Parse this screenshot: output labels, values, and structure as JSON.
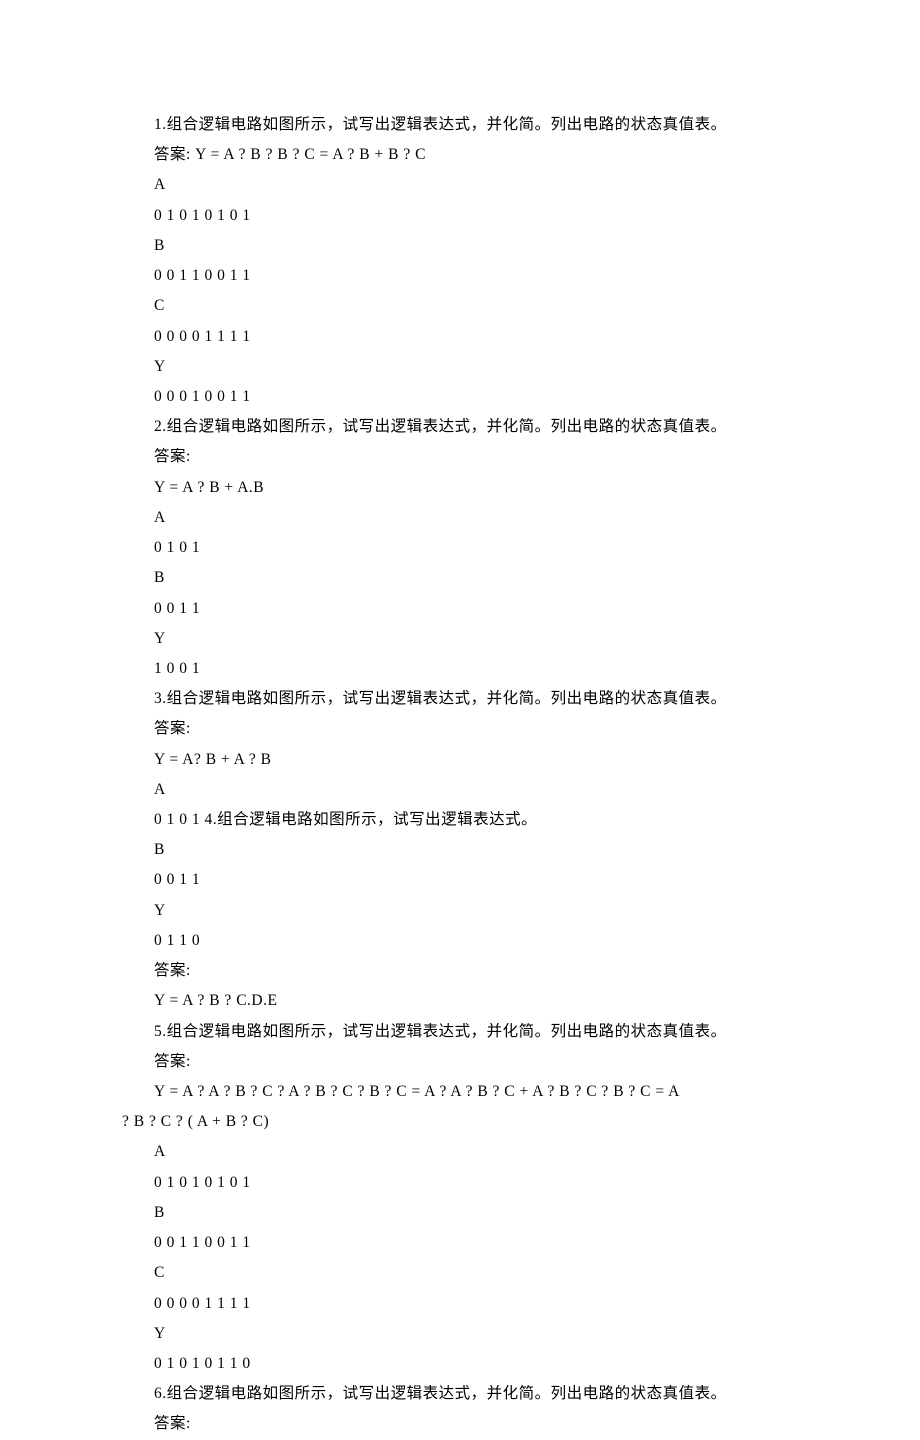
{
  "lines": [
    {
      "cls": "indent",
      "text": "1.组合逻辑电路如图所示，试写出逻辑表达式，并化简。列出电路的状态真值表。"
    },
    {
      "cls": "indent",
      "text": "答案: Y = A ? B ? B ? C = A ? B + B ? C"
    },
    {
      "cls": "indent",
      "text": "A"
    },
    {
      "cls": "indent",
      "text": "0 1 0 1 0 1 0 1"
    },
    {
      "cls": "indent",
      "text": "B"
    },
    {
      "cls": "indent",
      "text": "0 0 1 1 0 0 1 1"
    },
    {
      "cls": "indent",
      "text": "C"
    },
    {
      "cls": "indent",
      "text": "0 0 0 0 1 1 1 1"
    },
    {
      "cls": "indent",
      "text": "Y"
    },
    {
      "cls": "indent",
      "text": "0 0 0 1 0 0 1 1"
    },
    {
      "cls": "indent",
      "text": "2.组合逻辑电路如图所示，试写出逻辑表达式，并化简。列出电路的状态真值表。"
    },
    {
      "cls": "indent",
      "text": "答案:"
    },
    {
      "cls": "indent",
      "text": "Y = A ? B + A.B"
    },
    {
      "cls": "indent",
      "text": "A"
    },
    {
      "cls": "indent",
      "text": "0 1 0 1"
    },
    {
      "cls": "indent",
      "text": "B"
    },
    {
      "cls": "indent",
      "text": "0 0 1 1"
    },
    {
      "cls": "indent",
      "text": "Y"
    },
    {
      "cls": "indent",
      "text": "1 0 0 1"
    },
    {
      "cls": "indent",
      "text": "3.组合逻辑电路如图所示，试写出逻辑表达式，并化简。列出电路的状态真值表。"
    },
    {
      "cls": "indent",
      "text": "答案:"
    },
    {
      "cls": "indent",
      "text": "Y = A? B + A ? B"
    },
    {
      "cls": "indent",
      "text": "A"
    },
    {
      "cls": "indent",
      "text": "0 1 0 1 4.组合逻辑电路如图所示，试写出逻辑表达式。"
    },
    {
      "cls": "indent",
      "text": "B"
    },
    {
      "cls": "indent",
      "text": "0 0 1 1"
    },
    {
      "cls": "indent",
      "text": "Y"
    },
    {
      "cls": "indent",
      "text": "0 1 1 0"
    },
    {
      "cls": "indent",
      "text": "答案:"
    },
    {
      "cls": "indent",
      "text": "Y = A ? B ? C.D.E"
    },
    {
      "cls": "indent",
      "text": "5.组合逻辑电路如图所示，试写出逻辑表达式，并化简。列出电路的状态真值表。"
    },
    {
      "cls": "indent",
      "text": "答案:"
    },
    {
      "cls": "indent",
      "text": "Y = A ? A ? B ? C ? A ? B ? C ? B ? C = A ? A ? B ? C + A ? B ? C ? B ? C = A"
    },
    {
      "cls": "no-indent",
      "text": "? B ? C ? ( A + B ? C)"
    },
    {
      "cls": "indent",
      "text": "A"
    },
    {
      "cls": "indent",
      "text": "0 1 0 1 0 1 0 1"
    },
    {
      "cls": "indent",
      "text": "B"
    },
    {
      "cls": "indent",
      "text": "0 0 1 1 0 0 1 1"
    },
    {
      "cls": "indent",
      "text": "C"
    },
    {
      "cls": "indent",
      "text": "0 0 0 0 1 1 1 1"
    },
    {
      "cls": "indent",
      "text": "Y"
    },
    {
      "cls": "indent",
      "text": "0 1 0 1 0 1 1 0"
    },
    {
      "cls": "indent",
      "text": "6.组合逻辑电路如图所示，试写出逻辑表达式，并化简。列出电路的状态真值表。"
    },
    {
      "cls": "indent",
      "text": "答案:"
    }
  ]
}
